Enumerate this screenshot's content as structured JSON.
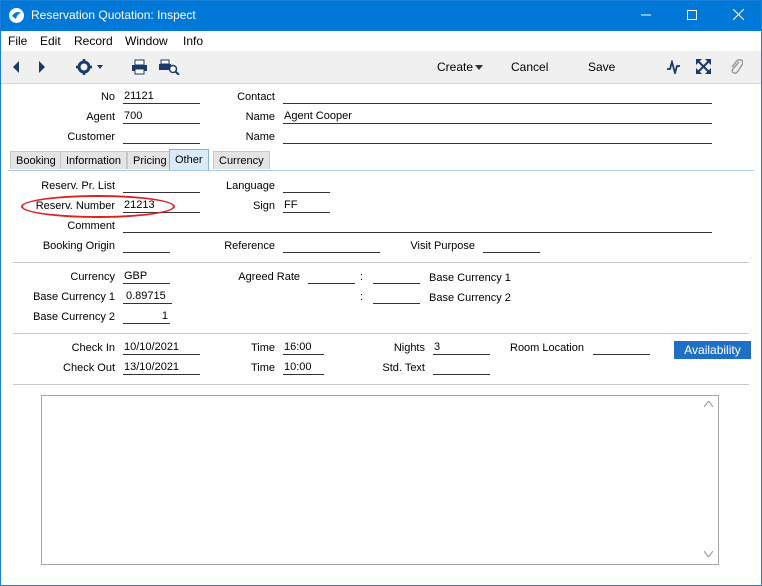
{
  "window": {
    "title": "Reservation Quotation: Inspect",
    "minimize": "—",
    "maximize": "☐",
    "close": "✕"
  },
  "menu": [
    "File",
    "Edit",
    "Record",
    "Window",
    "Info"
  ],
  "toolbar": {
    "create": "Create",
    "cancel": "Cancel",
    "save": "Save"
  },
  "header": {
    "no_label": "No",
    "no": "21121",
    "contact_label": "Contact",
    "contact": "",
    "agent_label": "Agent",
    "agent": "700",
    "agent_name_label": "Name",
    "agent_name": "Agent Cooper",
    "customer_label": "Customer",
    "customer": "",
    "customer_name_label": "Name",
    "customer_name": ""
  },
  "tabs": [
    "Booking",
    "Information",
    "Pricing",
    "Other",
    "Currency"
  ],
  "active_tab": "Other",
  "other": {
    "pr_list_label": "Reserv. Pr. List",
    "pr_list": "",
    "language_label": "Language",
    "language": "",
    "reserv_number_label": "Reserv. Number",
    "reserv_number": "21213",
    "sign_label": "Sign",
    "sign": "FF",
    "comment_label": "Comment",
    "comment": "",
    "booking_origin_label": "Booking Origin",
    "booking_origin": "",
    "reference_label": "Reference",
    "reference": "",
    "visit_purpose_label": "Visit Purpose",
    "visit_purpose": "",
    "currency_label": "Currency",
    "currency": "GBP",
    "agreed_rate_label": "Agreed Rate",
    "agreed_rate": "",
    "colon": ":",
    "base_currency_1_right_label": "Base Currency 1",
    "base_currency_1_label": "Base Currency 1",
    "base_currency_1": "0.89715",
    "base_currency_2_right_label": "Base Currency 2",
    "base_currency_2_label": "Base Currency 2",
    "base_currency_2": "1",
    "check_in_label": "Check In",
    "check_in": "10/10/2021",
    "time_in_label": "Time",
    "time_in": "16:00",
    "nights_label": "Nights",
    "nights": "3",
    "room_location_label": "Room Location",
    "room_location": "",
    "check_out_label": "Check Out",
    "check_out": "13/10/2021",
    "time_out_label": "Time",
    "time_out": "10:00",
    "std_text_label": "Std. Text",
    "std_text": "",
    "availability_button": "Availability"
  },
  "memo": {
    "text": ""
  },
  "colors": {
    "titlebar": "#0078d7",
    "highlight_ellipse": "#e02020",
    "availability": "#1f6fc6"
  }
}
